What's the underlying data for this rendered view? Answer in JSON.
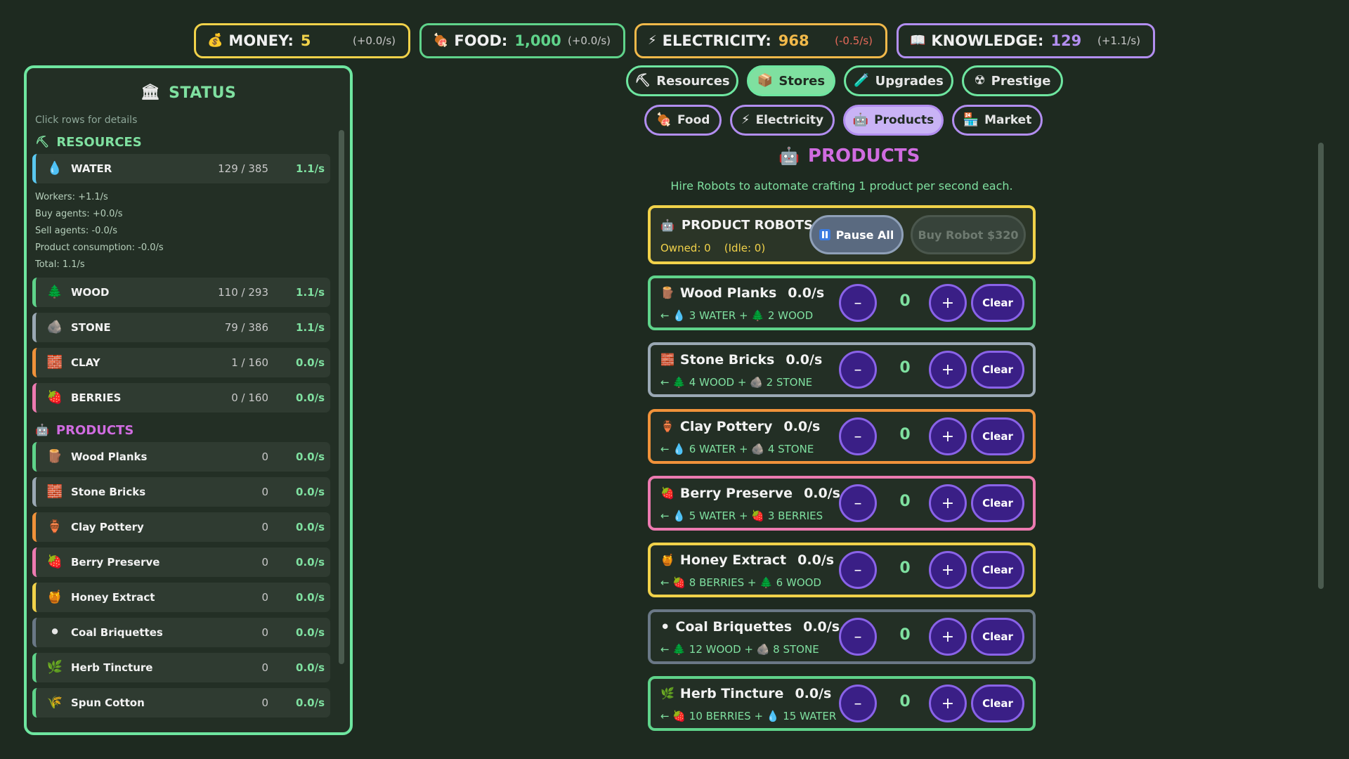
{
  "topbar": {
    "money": {
      "icon": "💰",
      "label": "MONEY:",
      "value": "5",
      "rate": "(+0.0/s)"
    },
    "food": {
      "icon": "🍖",
      "label": "FOOD:",
      "value": "1,000",
      "rate": "(+0.0/s)"
    },
    "electricity": {
      "icon": "⚡",
      "label": "ELECTRICITY:",
      "value": "968",
      "rate": "(-0.5/s)"
    },
    "knowledge": {
      "icon": "📖",
      "label": "KNOWLEDGE:",
      "value": "129",
      "rate": "(+1.1/s)"
    }
  },
  "status": {
    "title": "STATUS",
    "title_icon": "🏛",
    "hint": "Click rows for details",
    "resources_header": "RESOURCES",
    "resources_icon": "⛏",
    "products_header": "PRODUCTS",
    "products_icon": "🤖",
    "water": {
      "icon": "💧",
      "name": "WATER",
      "amount": "129 / 385",
      "rate": "1.1/s"
    },
    "water_details": [
      "Workers: +1.1/s",
      "Buy agents: +0.0/s",
      "Sell agents: -0.0/s",
      "Product consumption: -0.0/s",
      "Total: 1.1/s"
    ],
    "wood": {
      "icon": "🌲",
      "name": "WOOD",
      "amount": "110 / 293",
      "rate": "1.1/s"
    },
    "stone": {
      "icon": "🪨",
      "name": "STONE",
      "amount": "79 / 386",
      "rate": "1.1/s"
    },
    "clay": {
      "icon": "🧱",
      "name": "CLAY",
      "amount": "1 / 160",
      "rate": "0.0/s"
    },
    "berries": {
      "icon": "🍓",
      "name": "BERRIES",
      "amount": "0 / 160",
      "rate": "0.0/s"
    },
    "products": [
      {
        "icon": "🪵",
        "name": "Wood Planks",
        "amount": "0",
        "rate": "0.0/s"
      },
      {
        "icon": "🧱",
        "name": "Stone Bricks",
        "amount": "0",
        "rate": "0.0/s"
      },
      {
        "icon": "🏺",
        "name": "Clay Pottery",
        "amount": "0",
        "rate": "0.0/s"
      },
      {
        "icon": "🍓",
        "name": "Berry Preserve",
        "amount": "0",
        "rate": "0.0/s"
      },
      {
        "icon": "🍯",
        "name": "Honey Extract",
        "amount": "0",
        "rate": "0.0/s"
      },
      {
        "icon": "⚫",
        "name": "Coal Briquettes",
        "amount": "0",
        "rate": "0.0/s"
      },
      {
        "icon": "🌿",
        "name": "Herb Tincture",
        "amount": "0",
        "rate": "0.0/s"
      },
      {
        "icon": "🌾",
        "name": "Spun Cotton",
        "amount": "0",
        "rate": "0.0/s"
      }
    ]
  },
  "nav": {
    "main": [
      {
        "icon": "⛏",
        "label": "Resources"
      },
      {
        "icon": "📦",
        "label": "Stores"
      },
      {
        "icon": "🧪",
        "label": "Upgrades"
      },
      {
        "icon": "☢",
        "label": "Prestige"
      }
    ],
    "sub": [
      {
        "icon": "🍖",
        "label": "Food"
      },
      {
        "icon": "⚡",
        "label": "Electricity"
      },
      {
        "icon": "🤖",
        "label": "Products"
      },
      {
        "icon": "🏪",
        "label": "Market"
      }
    ]
  },
  "main": {
    "title": "PRODUCTS",
    "title_icon": "🤖",
    "subtitle": "Hire Robots to automate crafting 1 product per second each.",
    "robots": {
      "icon": "🤖",
      "title": "PRODUCT ROBOTS",
      "owned": "Owned: 0    (Idle: 0)",
      "pause_label": "Pause All",
      "buy_label": "Buy Robot $320"
    },
    "minus_label": "–",
    "plus_label": "+",
    "clear_label": "Clear",
    "products": [
      {
        "icon": "🪵",
        "name": "Wood Planks",
        "rate": "0.0/s",
        "recipe": "← 💧 3 WATER + 🌲 2 WOOD",
        "count": "0",
        "border": "#5fd38a"
      },
      {
        "icon": "🧱",
        "name": "Stone Bricks",
        "rate": "0.0/s",
        "recipe": "← 🌲 4 WOOD + 🪨 2 STONE",
        "count": "0",
        "border": "#9aa8b4"
      },
      {
        "icon": "🏺",
        "name": "Clay Pottery",
        "rate": "0.0/s",
        "recipe": "← 💧 6 WATER + 🪨 4 STONE",
        "count": "0",
        "border": "#f0923a"
      },
      {
        "icon": "🍓",
        "name": "Berry Preserve",
        "rate": "0.0/s",
        "recipe": "← 💧 5 WATER + 🍓 3 BERRIES",
        "count": "0",
        "border": "#ec7ab0"
      },
      {
        "icon": "🍯",
        "name": "Honey Extract",
        "rate": "0.0/s",
        "recipe": "← 🍓 8 BERRIES + 🌲 6 WOOD",
        "count": "0",
        "border": "#f1d24a"
      },
      {
        "icon": "⚫",
        "name": "Coal Briquettes",
        "rate": "0.0/s",
        "recipe": "← 🌲 12 WOOD + 🪨 8 STONE",
        "count": "0",
        "border": "#6a7886"
      },
      {
        "icon": "🌿",
        "name": "Herb Tincture",
        "rate": "0.0/s",
        "recipe": "← 🍓 10 BERRIES + 💧 15 WATER",
        "count": "0",
        "border": "#5fd38a"
      }
    ]
  },
  "colors": {
    "green_accent": "#6ee6a0",
    "purple_accent": "#b28ef0",
    "gold_accent": "#f1d24a",
    "magenta_title": "#d06ce0",
    "button_purple": "#3a1f86"
  }
}
